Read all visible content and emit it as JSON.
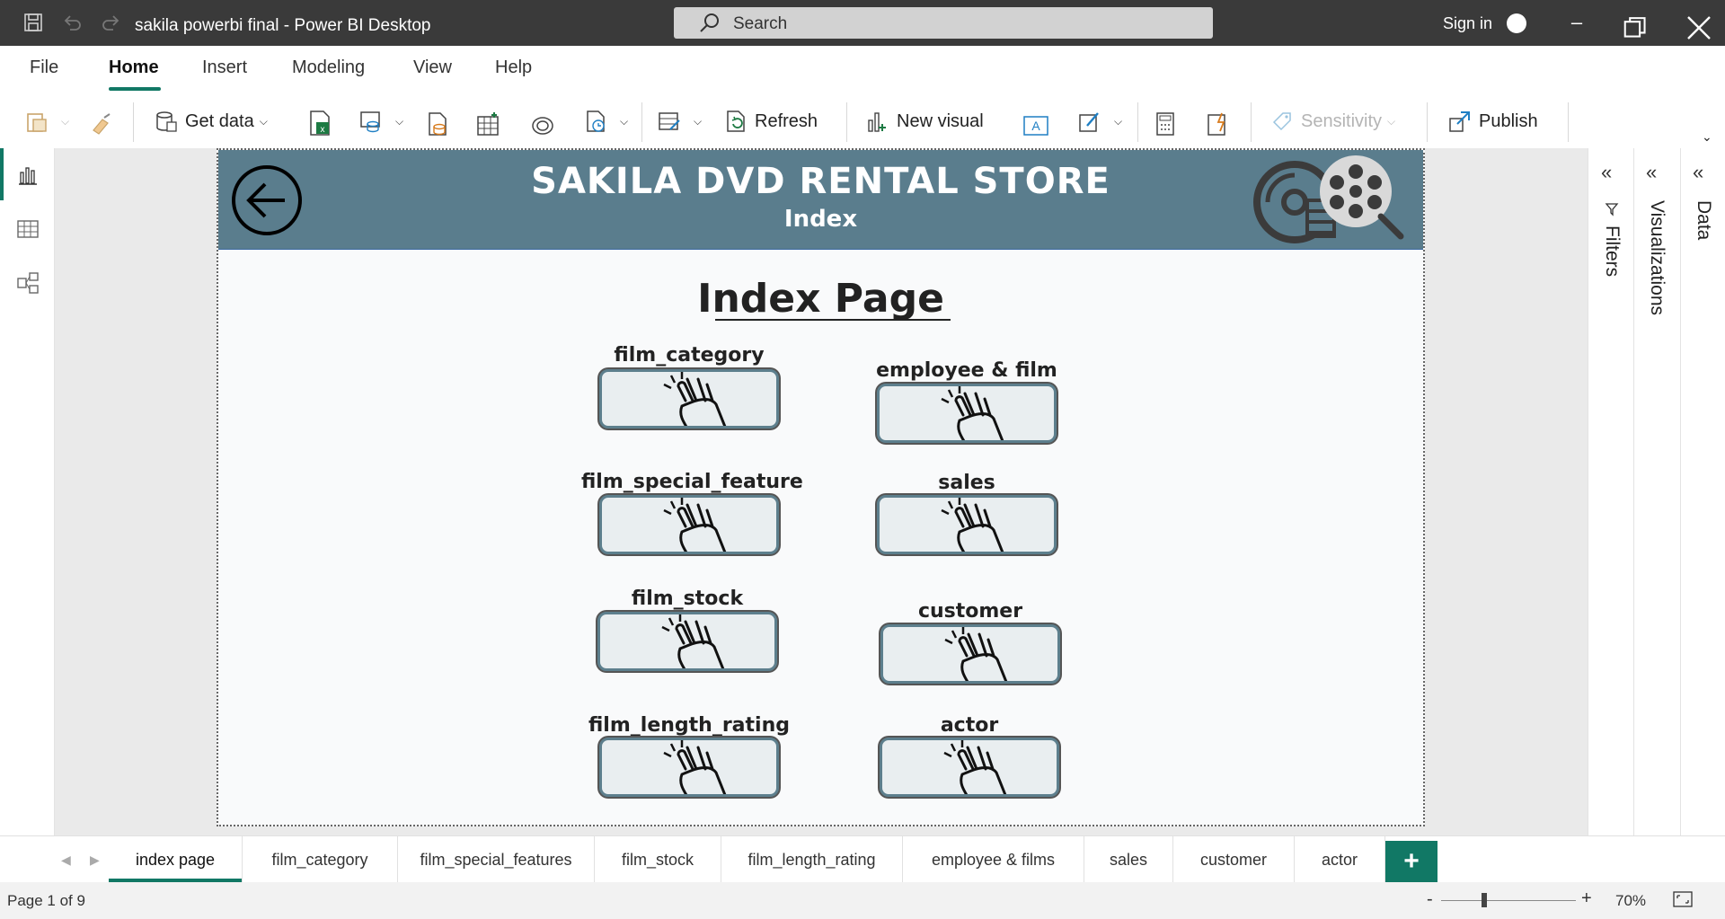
{
  "app": {
    "window_title": "sakila powerbi final - Power BI Desktop",
    "search_placeholder": "Search",
    "sign_in": "Sign in"
  },
  "menu": [
    "File",
    "Home",
    "Insert",
    "Modeling",
    "View",
    "Help"
  ],
  "ribbon": {
    "get_data": "Get data",
    "refresh": "Refresh",
    "new_visual": "New visual",
    "sensitivity": "Sensitivity",
    "publish": "Publish"
  },
  "report": {
    "banner_title": "SAKILA DVD RENTAL STORE",
    "banner_subtitle": "Index",
    "page_title": "Index Page",
    "buttons": [
      {
        "label": "film_category"
      },
      {
        "label": "employee & film"
      },
      {
        "label": "film_special_feature"
      },
      {
        "label": "sales"
      },
      {
        "label": "film_stock"
      },
      {
        "label": "customer"
      },
      {
        "label": "film_length_rating"
      },
      {
        "label": "actor"
      }
    ]
  },
  "panes": {
    "filters": "Filters",
    "visualizations": "Visualizations",
    "data": "Data"
  },
  "tabs": [
    "index page",
    "film_category",
    "film_special_features",
    "film_stock",
    "film_length_rating",
    "employee & films",
    "sales",
    "customer",
    "actor"
  ],
  "active_tab": "index page",
  "status": {
    "page": "Page 1 of 9",
    "zoom": "70%"
  },
  "colors": {
    "accent": "#117865",
    "banner": "#5a7d8d",
    "titlebar": "#3a3a3a"
  }
}
